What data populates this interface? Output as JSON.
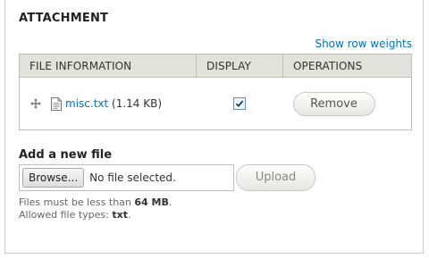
{
  "fieldset": {
    "legend": "ATTACHMENT",
    "row_weights_link": "Show row weights"
  },
  "table": {
    "headers": [
      "FILE INFORMATION",
      "DISPLAY",
      "OPERATIONS"
    ],
    "rows": [
      {
        "file_name": "misc.txt",
        "file_size": "(1.14 KB)",
        "display_checked": true,
        "remove_label": "Remove"
      }
    ]
  },
  "add_file": {
    "label": "Add a new file",
    "browse_label": "Browse...",
    "no_file_text": "No file selected.",
    "upload_label": "Upload"
  },
  "description": {
    "size_prefix": "Files must be less than ",
    "size_value": "64 MB",
    "size_suffix": ".",
    "types_prefix": "Allowed file types: ",
    "types_value": "txt",
    "types_suffix": "."
  },
  "colors": {
    "link": "#0074bd",
    "table_header_bg": "#e1e2dc",
    "border": "#bfbfba"
  },
  "icons": {
    "drag": "drag-handle-icon",
    "file": "text-file-icon",
    "checkbox": "checkbox-checked-icon"
  }
}
